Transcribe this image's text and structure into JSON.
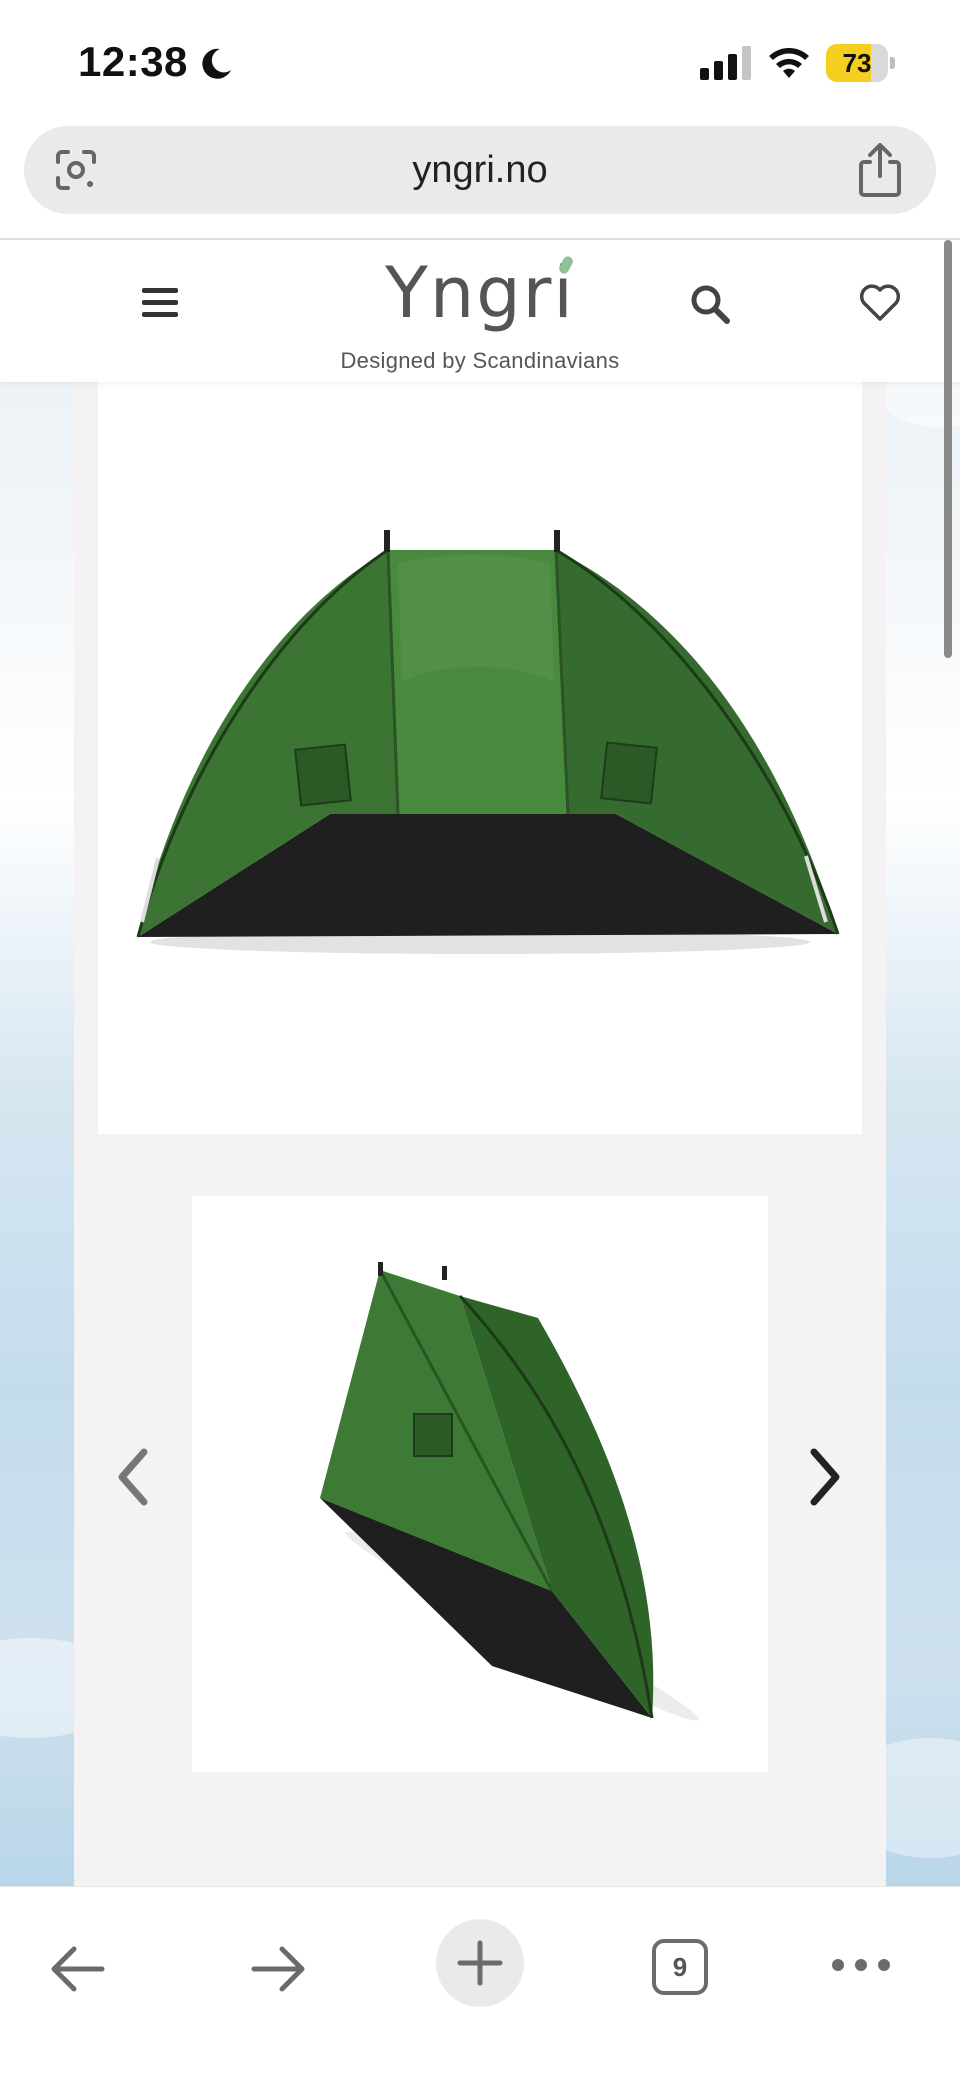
{
  "status_bar": {
    "time": "12:38",
    "battery_level": 73,
    "battery_text": "73",
    "icons": [
      "moon-icon",
      "signal-icon",
      "wifi-icon",
      "battery-icon"
    ]
  },
  "browser": {
    "url": "yngri.no",
    "open_tabs": "9",
    "icons": [
      "lens-icon",
      "share-icon",
      "back-icon",
      "forward-icon",
      "plus-icon",
      "tabs-icon",
      "more-icon"
    ]
  },
  "site_header": {
    "logo": "Yngri",
    "tagline": "Designed by Scandinavians",
    "icons": [
      "menu-icon",
      "search-icon",
      "heart-icon"
    ]
  },
  "product_gallery": {
    "main_image": "green beach tent front view",
    "thumbnail": "green beach tent side view",
    "icons": [
      "chevron-left-icon",
      "chevron-right-icon"
    ]
  },
  "colors": {
    "tent_green": "#3d7a35",
    "tent_dark": "#2b5c26",
    "battery_yellow": "#f5cf1f",
    "gallery_bg": "#f4f2f3"
  }
}
